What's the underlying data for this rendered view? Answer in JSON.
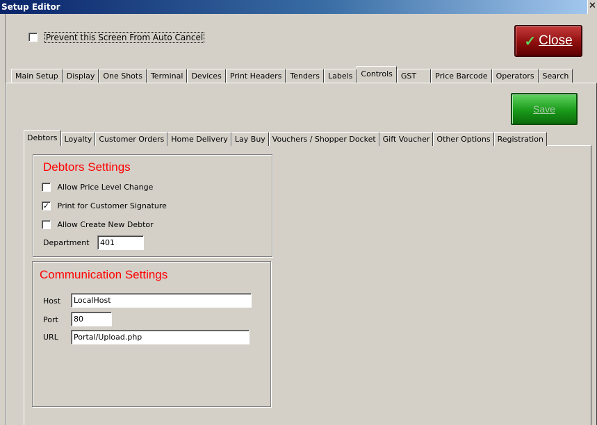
{
  "window": {
    "title": "Setup Editor",
    "close_glyph": "✕"
  },
  "auto_cancel": {
    "label": "Prevent this Screen From Auto Cancel",
    "checked": false
  },
  "close_button": {
    "label": "Close",
    "icon": "check-icon"
  },
  "save_button": {
    "label": "Save"
  },
  "top_tabs": [
    "Main Setup",
    "Display",
    "One Shots",
    "Terminal",
    "Devices",
    "Print Headers",
    "Tenders",
    "Labels",
    "Controls",
    "GST",
    "Price Barcode",
    "Operators",
    "Search"
  ],
  "top_tab_active": "Controls",
  "inner_tabs": [
    "Debtors",
    "Loyalty",
    "Customer Orders",
    "Home Delivery",
    "Lay Buy",
    "Vouchers / Shopper Docket",
    "Gift Voucher",
    "Other Options",
    "Registration"
  ],
  "inner_tab_active": "Debtors",
  "debtors": {
    "title": "Debtors Settings",
    "options": [
      {
        "label": "Allow Price Level Change",
        "checked": false
      },
      {
        "label": "Print for  Customer Signature",
        "checked": true
      },
      {
        "label": "Allow Create New Debtor",
        "checked": false
      }
    ],
    "department_label": "Department",
    "department_value": "401"
  },
  "communication": {
    "title": "Communication Settings",
    "host_label": "Host",
    "host_value": "LocalHost",
    "port_label": "Port",
    "port_value": "80",
    "url_label": "URL",
    "url_value": "Portal/Upload.php"
  },
  "colors": {
    "title_bar": "#0a246a",
    "close_button": "#8e0e0e",
    "save_button": "#1a9a1a",
    "group_title": "#ff0000"
  }
}
